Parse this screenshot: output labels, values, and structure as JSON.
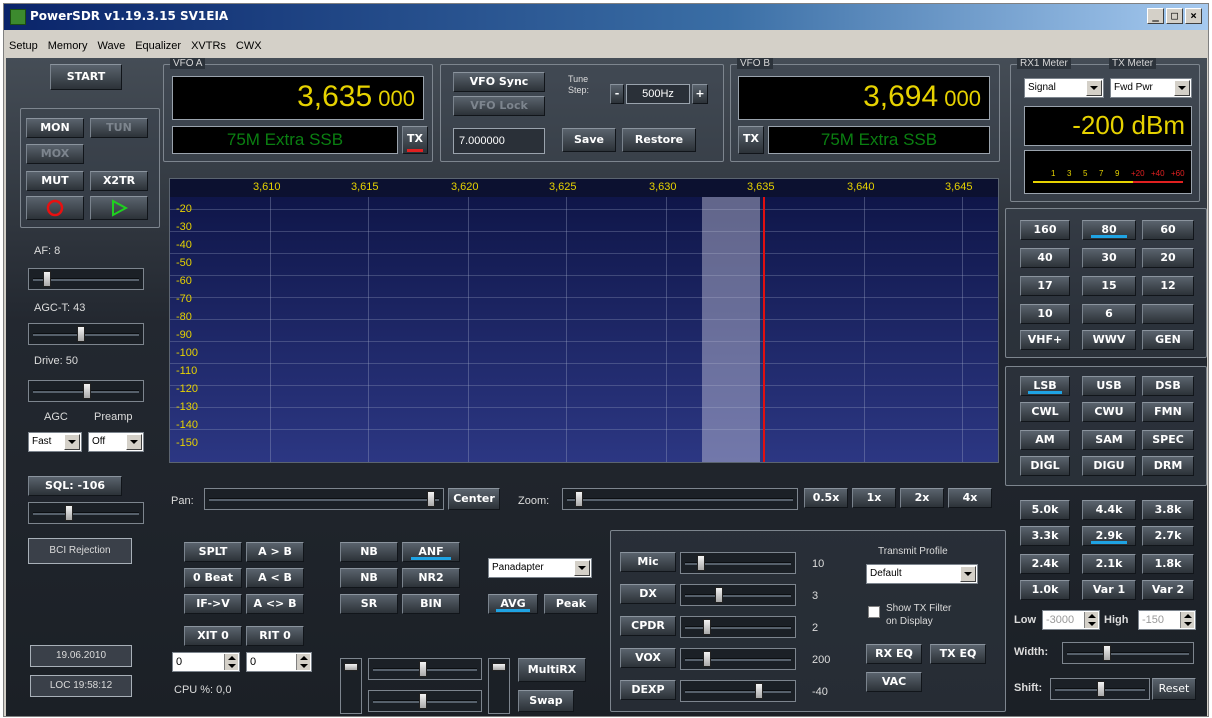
{
  "window": {
    "title": "PowerSDR  v1.19.3.15  SV1EIA"
  },
  "menu": [
    "Setup",
    "Memory",
    "Wave",
    "Equalizer",
    "XVTRs",
    "CWX"
  ],
  "left": {
    "start": "START",
    "mon": "MON",
    "tun": "TUN",
    "mox": "MOX",
    "mut": "MUT",
    "x2tr": "X2TR",
    "af": "AF:  8",
    "agct": "AGC-T:  43",
    "drive": "Drive:  50",
    "agc_label": "AGC",
    "preamp_label": "Preamp",
    "agc_value": "Fast",
    "preamp_value": "Off",
    "sql": "SQL: -106",
    "bci": "BCI Rejection",
    "date": "19.06.2010",
    "time": "LOC 19:58:12"
  },
  "vfo_a": {
    "label": "VFO A",
    "freq_main": "3,635",
    "freq_sub": " 000",
    "band": "75M Extra SSB",
    "tx": "TX"
  },
  "vfo_b": {
    "label": "VFO B",
    "freq_main": "3,694",
    "freq_sub": " 000",
    "band": "75M Extra SSB",
    "tx": "TX"
  },
  "vfo_mid": {
    "sync": "VFO Sync",
    "lock": "VFO Lock",
    "tune_step_label": "Tune\nStep:",
    "step": "500Hz",
    "minus": "-",
    "plus": "+",
    "freq_entry": "7.000000",
    "save": "Save",
    "restore": "Restore"
  },
  "meters": {
    "rx_label": "RX1 Meter",
    "tx_label": "TX Meter",
    "rx_mode": "Signal",
    "tx_mode": "Fwd Pwr",
    "value": "-200 dBm",
    "scale": [
      "1",
      "3",
      "5",
      "7",
      "9",
      "+20",
      "+40",
      "+60"
    ]
  },
  "display": {
    "freq_labels": [
      "3,610",
      "3,615",
      "3,620",
      "3,625",
      "3,630",
      "3,635",
      "3,640",
      "3,645"
    ],
    "db_labels": [
      "-20",
      "-30",
      "-40",
      "-50",
      "-60",
      "-70",
      "-80",
      "-90",
      "-100",
      "-110",
      "-120",
      "-130",
      "-140",
      "-150"
    ]
  },
  "pan": {
    "pan_label": "Pan:",
    "center": "Center",
    "zoom_label": "Zoom:",
    "zooms": [
      "0.5x",
      "1x",
      "2x",
      "4x"
    ]
  },
  "bands": [
    "160",
    "80",
    "60",
    "40",
    "30",
    "20",
    "17",
    "15",
    "12",
    "10",
    "6",
    "",
    "VHF+",
    "WWV",
    "GEN"
  ],
  "modes": [
    "LSB",
    "USB",
    "DSB",
    "CWL",
    "CWU",
    "FMN",
    "AM",
    "SAM",
    "SPEC",
    "DIGL",
    "DIGU",
    "DRM"
  ],
  "filters": [
    "5.0k",
    "4.4k",
    "3.8k",
    "3.3k",
    "2.9k",
    "2.7k",
    "2.4k",
    "2.1k",
    "1.8k",
    "1.0k",
    "Var 1",
    "Var 2"
  ],
  "filter_ctrl": {
    "low_label": "Low",
    "low": "-3000",
    "high_label": "High",
    "high": "-150",
    "width": "Width:",
    "shift": "Shift:",
    "reset": "Reset"
  },
  "bottom": {
    "splt": "SPLT",
    "a_to_b": "A > B",
    "zerobeat": "0 Beat",
    "b_to_a": "A < B",
    "if_v": "IF->V",
    "swap_ab": "A <> B",
    "xit": "XIT",
    "xit_val": "0",
    "rit": "RIT",
    "rit_val": "0",
    "xit_spin": "0",
    "rit_spin": "0",
    "cpu": "CPU %:  0,0",
    "nb": "NB",
    "anf": "ANF",
    "nb2": "NB",
    "nr2": "NR2",
    "sr": "SR",
    "bin": "BIN",
    "display_mode": "Panadapter",
    "avg": "AVG",
    "peak": "Peak",
    "multirx": "MultiRX",
    "swap": "Swap"
  },
  "tx": {
    "mic": "Mic",
    "mic_val": "10",
    "dx": "DX",
    "dx_val": "3",
    "cpdr": "CPDR",
    "cpdr_val": "2",
    "vox": "VOX",
    "vox_val": "200",
    "dexp": "DEXP",
    "dexp_val": "-40",
    "profile_label": "Transmit Profile",
    "profile": "Default",
    "show_tx": "Show TX Filter\non Display",
    "rx_eq": "RX EQ",
    "tx_eq": "TX EQ",
    "vac": "VAC"
  },
  "colors": {
    "accent": "#1fa3e3",
    "freq": "#e6d200",
    "band_text": "#0a7f11",
    "tx_indicator": "#e02020"
  }
}
